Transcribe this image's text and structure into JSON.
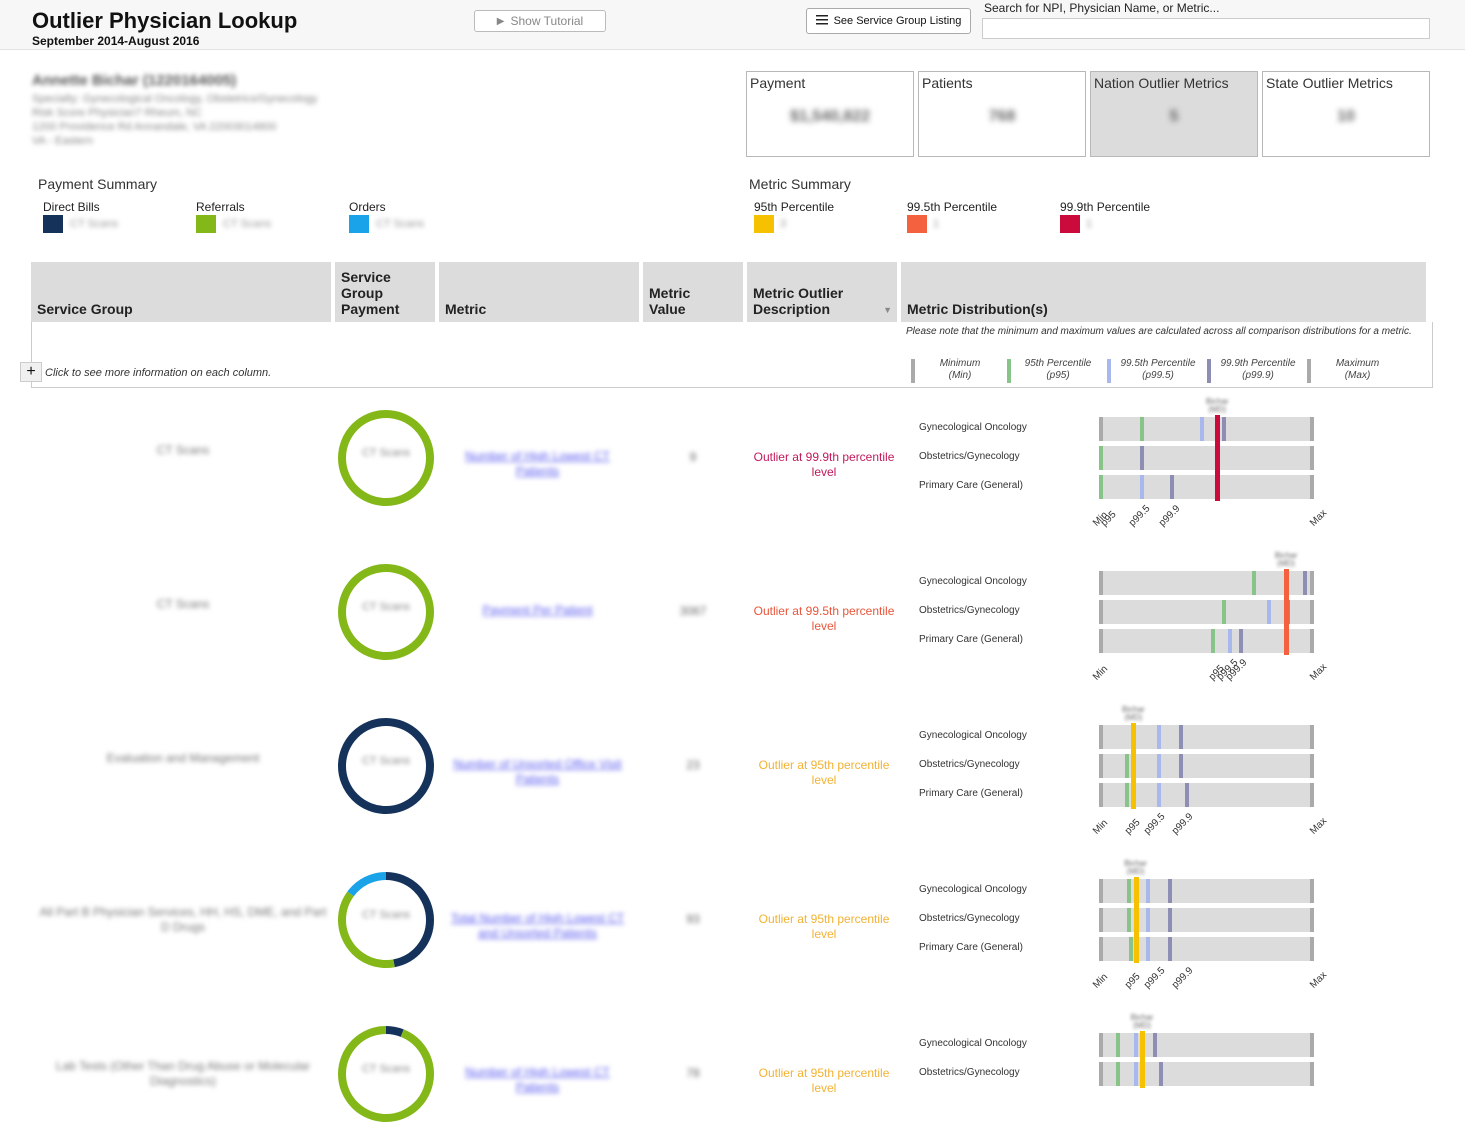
{
  "app": {
    "title": "Outlier Physician Lookup",
    "subtitle": "September 2014-August 2016",
    "tutorial_label": "Show Tutorial",
    "listing_label": "See Service Group Listing",
    "search_label": "Search for NPI, Physician Name, or Metric...",
    "search_value": ""
  },
  "physician": {
    "name": "Annette Bichar (1220164005)",
    "lines": [
      "Specialty: Gynecological Oncology, Obstetrics/Gynecology",
      "Risk Score Physician? Rheum, NC",
      "1200 Providence Rd Annandale, VA 22003014800",
      "VA - Eastern"
    ]
  },
  "kpis": [
    {
      "label": "Payment",
      "value": "$1,540,822"
    },
    {
      "label": "Patients",
      "value": "768"
    },
    {
      "label": "Nation Outlier Metrics",
      "value": "5"
    },
    {
      "label": "State Outlier Metrics",
      "value": "10"
    }
  ],
  "payment_summary": {
    "title": "Payment Summary",
    "items": [
      {
        "label": "Direct Bills",
        "color": "#14325a",
        "value": "CT Scans"
      },
      {
        "label": "Referrals",
        "color": "#84b818",
        "value": "CT Scans"
      },
      {
        "label": "Orders",
        "color": "#1aa3e8",
        "value": "CT Scans"
      }
    ]
  },
  "metric_summary": {
    "title": "Metric Summary",
    "items": [
      {
        "label": "95th Percentile",
        "color": "#f5c100",
        "value": "3"
      },
      {
        "label": "99.5th Percentile",
        "color": "#f4613f",
        "value": "1"
      },
      {
        "label": "99.9th Percentile",
        "color": "#cc0b3d",
        "value": "1"
      }
    ]
  },
  "table": {
    "headers": {
      "service_group": "Service Group",
      "payment": "Service Group Payment",
      "metric": "Metric",
      "metric_value": "Metric Value",
      "outlier_desc": "Metric Outlier Description",
      "distribution": "Metric Distribution(s)"
    },
    "click_hint": "Click to see more information on each column.",
    "note": "Please note that the minimum and maximum values are calculated across all comparison distributions for a metric.",
    "key": [
      {
        "line1": "Minimum",
        "line2": "(Min)",
        "color": "#aaaaaa"
      },
      {
        "line1": "95th Percentile",
        "line2": "(p95)",
        "color": "#88c488"
      },
      {
        "line1": "99.5th Percentile",
        "line2": "(p99.5)",
        "color": "#a9b8ec"
      },
      {
        "line1": "99.9th Percentile",
        "line2": "(p99.9)",
        "color": "#8e8eb4"
      },
      {
        "line1": "Maximum",
        "line2": "(Max)",
        "color": "#aaaaaa"
      }
    ],
    "physician_tick_label": "Bichar (MD)",
    "axis_labels": {
      "min": "Min",
      "p95": "p95",
      "p995": "p99.5",
      "p999": "p99.9",
      "max": "Max"
    },
    "rows": [
      {
        "service_group": "CT Scans",
        "donut_label": "CT Scans",
        "donut": [
          {
            "color": "#84b818",
            "fraction": 1.0
          }
        ],
        "metric": "Number of High Lowest CT Patients",
        "metric_value": "9",
        "outlier_desc": "Outlier at 99.9th percentile level",
        "outlier_color": "#c2185b",
        "physician_pos": 0.55,
        "physician_color": "#cc0b3d",
        "distributions": [
          {
            "name": "Gynecological Oncology",
            "p95": 0.2,
            "p995": 0.48,
            "p999": 0.58
          },
          {
            "name": "Obstetrics/Gynecology",
            "p95": 0.0,
            "p995": 0.2,
            "p999": 0.2
          },
          {
            "name": "Primary Care (General)",
            "p95": 0.0,
            "p995": 0.2,
            "p999": 0.34
          }
        ],
        "axis_ticks": {
          "p95": 0.0,
          "p995": 0.13,
          "p999": 0.27
        }
      },
      {
        "service_group": "CT Scans",
        "donut_label": "CT Scans",
        "donut": [
          {
            "color": "#84b818",
            "fraction": 1.0
          }
        ],
        "metric": "Payment Per Patient",
        "metric_value": "3067",
        "outlier_desc": "Outlier at 99.5th percentile level",
        "outlier_color": "#e8553a",
        "physician_pos": 0.87,
        "physician_color": "#f4613f",
        "distributions": [
          {
            "name": "Gynecological Oncology",
            "p95": 0.72,
            "p995": 0.87,
            "p999": 0.96
          },
          {
            "name": "Obstetrics/Gynecology",
            "p95": 0.58,
            "p995": 0.79,
            "p999": 0.88
          },
          {
            "name": "Primary Care (General)",
            "p95": 0.53,
            "p995": 0.61,
            "p999": 0.66
          }
        ],
        "axis_ticks": {
          "p95": 0.5,
          "p995": 0.54,
          "p999": 0.58
        }
      },
      {
        "service_group": "Evaluation and Management",
        "donut_label": "CT Scans",
        "donut": [
          {
            "color": "#14325a",
            "fraction": 1.0
          }
        ],
        "metric": "Number of Unsorted Office Visit Patients",
        "metric_value": "23",
        "outlier_desc": "Outlier at 95th percentile level",
        "outlier_color": "#f2b233",
        "physician_pos": 0.16,
        "physician_color": "#f5c100",
        "distributions": [
          {
            "name": "Gynecological Oncology",
            "p95": 0.16,
            "p995": 0.28,
            "p999": 0.38
          },
          {
            "name": "Obstetrics/Gynecology",
            "p95": 0.13,
            "p995": 0.28,
            "p999": 0.38
          },
          {
            "name": "Primary Care (General)",
            "p95": 0.13,
            "p995": 0.28,
            "p999": 0.41
          }
        ],
        "axis_ticks": {
          "p95": 0.11,
          "p995": 0.2,
          "p999": 0.33
        }
      },
      {
        "service_group": "All Part B Physician Services, HH, HS, DME, and Part D Drugs",
        "donut_label": "CT Scans",
        "donut": [
          {
            "color": "#14325a",
            "fraction": 0.47
          },
          {
            "color": "#84b818",
            "fraction": 0.38
          },
          {
            "color": "#1aa3e8",
            "fraction": 0.15
          }
        ],
        "metric": "Total Number of High Lowest CT and Unsorted Patients",
        "metric_value": "93",
        "outlier_desc": "Outlier at 95th percentile level",
        "outlier_color": "#f2b233",
        "physician_pos": 0.17,
        "physician_color": "#f5c100",
        "distributions": [
          {
            "name": "Gynecological Oncology",
            "p95": 0.14,
            "p995": 0.23,
            "p999": 0.33
          },
          {
            "name": "Obstetrics/Gynecology",
            "p95": 0.14,
            "p995": 0.23,
            "p999": 0.33
          },
          {
            "name": "Primary Care (General)",
            "p95": 0.15,
            "p995": 0.23,
            "p999": 0.33
          }
        ],
        "axis_ticks": {
          "p95": 0.11,
          "p995": 0.2,
          "p999": 0.33
        }
      },
      {
        "service_group": "Lab Tests (Other Than Drug Abuse or Molecular Diagnostics)",
        "donut_label": "CT Scans",
        "donut": [
          {
            "color": "#14325a",
            "fraction": 0.06
          },
          {
            "color": "#84b818",
            "fraction": 0.94
          }
        ],
        "metric": "Number of High Lowest CT Patients",
        "metric_value": "78",
        "outlier_desc": "Outlier at 95th percentile level",
        "outlier_color": "#f2b233",
        "physician_pos": 0.2,
        "physician_color": "#f5c100",
        "distributions": [
          {
            "name": "Gynecological Oncology",
            "p95": 0.09,
            "p995": 0.17,
            "p999": 0.26
          },
          {
            "name": "Obstetrics/Gynecology",
            "p95": 0.09,
            "p995": 0.17,
            "p999": 0.29
          }
        ],
        "axis_ticks": null
      }
    ]
  }
}
